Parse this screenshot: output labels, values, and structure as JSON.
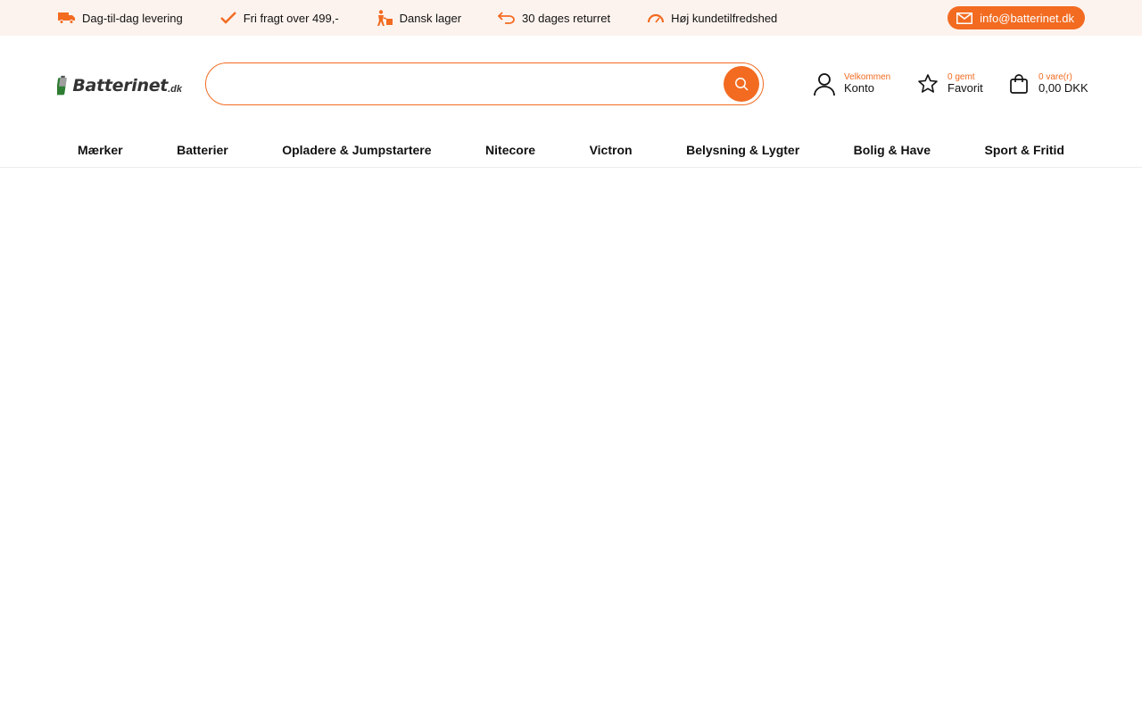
{
  "usp_bar": {
    "items": [
      {
        "label": "Dag-til-dag levering",
        "icon": "truck-icon"
      },
      {
        "label": "Fri fragt over 499,-",
        "icon": "checkmark-icon"
      },
      {
        "label": "Dansk lager",
        "icon": "warehouse-worker-icon"
      },
      {
        "label": "30 dages returret",
        "icon": "return-arrow-icon"
      },
      {
        "label": "Høj kundetilfredshed",
        "icon": "gauge-icon"
      }
    ],
    "email": {
      "label": "info@batterinet.dk",
      "icon": "mail-icon"
    }
  },
  "header": {
    "logo": {
      "text": "Batterinet",
      "tld": ".dk"
    },
    "search": {
      "placeholder": "",
      "value": "",
      "button_icon": "search-icon"
    },
    "account": {
      "small": "Velkommen",
      "main": "Konto",
      "icon": "user-icon"
    },
    "favorites": {
      "small": "0 gemt",
      "main": "Favorit",
      "icon": "star-icon"
    },
    "cart": {
      "small": "0 vare(r)",
      "main": "0,00 DKK",
      "icon": "shopping-bag-icon"
    }
  },
  "nav": {
    "items": [
      "Mærker",
      "Batterier",
      "Opladere & Jumpstartere",
      "Nitecore",
      "Victron",
      "Belysning & Lygter",
      "Bolig & Have",
      "Sport & Fritid"
    ]
  },
  "colors": {
    "accent": "#f26b21",
    "usp_background": "#fdf3ee",
    "text": "#111111"
  }
}
